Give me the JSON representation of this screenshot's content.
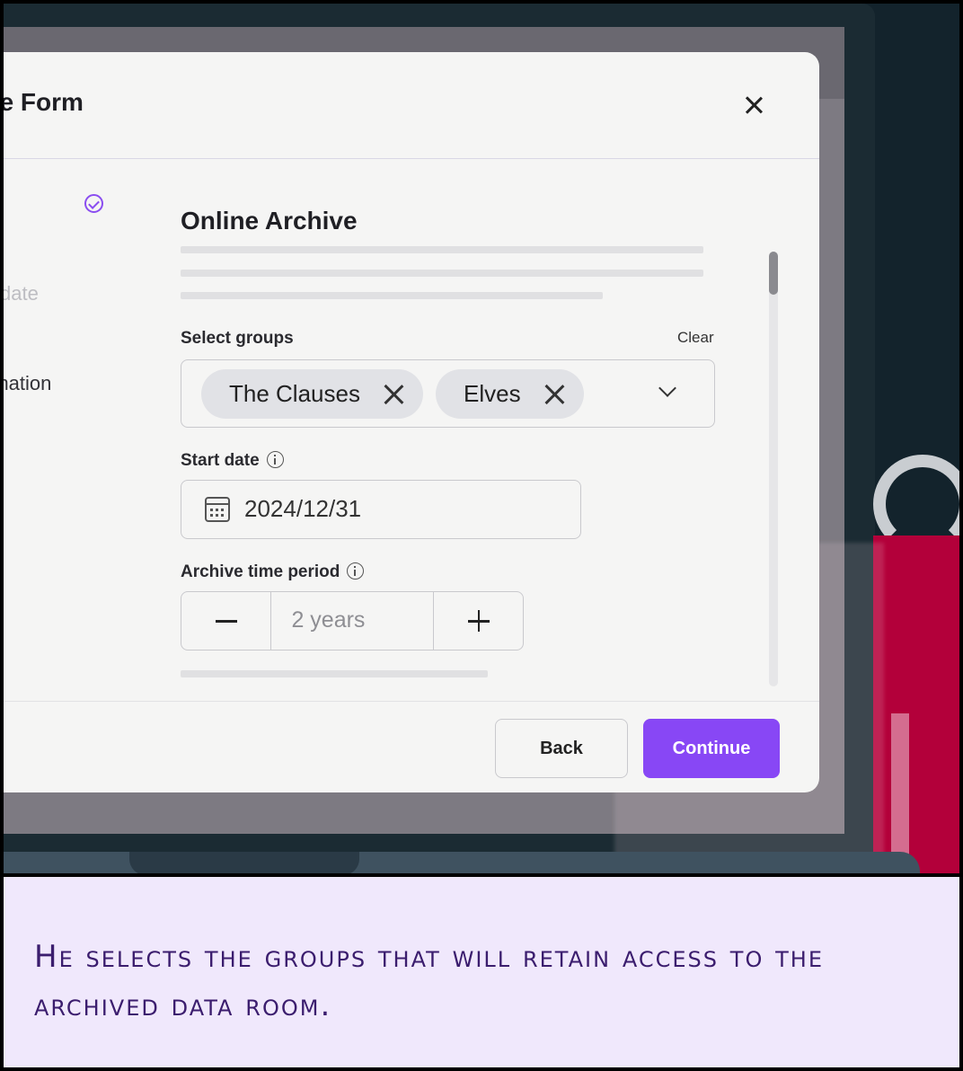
{
  "modal": {
    "title": "ve Form",
    "steps": [
      {
        "label": "date",
        "state": "upcoming"
      },
      {
        "label": "rmation",
        "state": "current"
      }
    ],
    "section_title": "Online Archive",
    "select_groups": {
      "label": "Select groups",
      "clear_label": "Clear",
      "chips": [
        "The Clauses",
        "Elves"
      ]
    },
    "start_date": {
      "label": "Start date",
      "value": "2024/12/31"
    },
    "archive_period": {
      "label": "Archive time period",
      "value": "2 years"
    },
    "footer": {
      "back_label": "Back",
      "continue_label": "Continue"
    }
  },
  "caption": "He selects the groups that will retain access to the archived data room.",
  "colors": {
    "accent": "#8847f5",
    "caption_bg": "#f0e8fc",
    "caption_text": "#3b1d6e"
  }
}
